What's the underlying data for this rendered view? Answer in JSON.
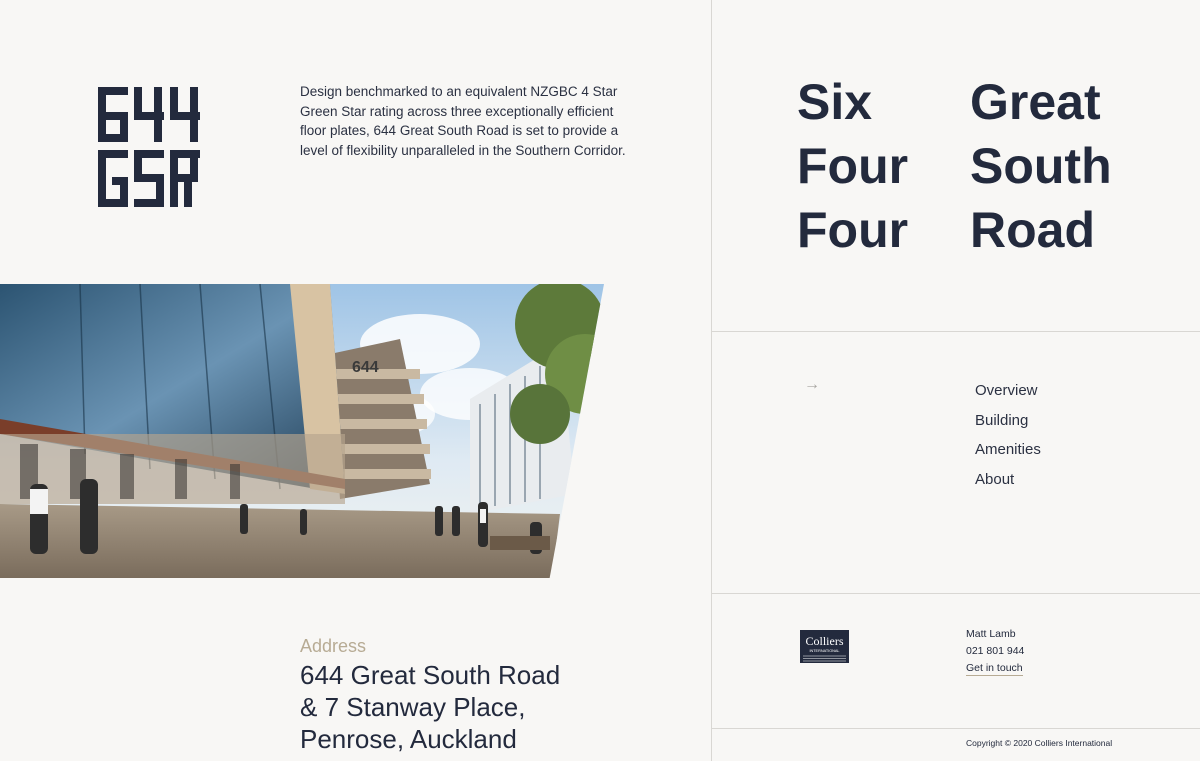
{
  "brand": {
    "logo_lines": [
      "644",
      "GSR"
    ]
  },
  "intro": {
    "text": "Design benchmarked to an equivalent NZGBC 4 Star Green Star rating across three exceptionally efficient floor plates, 644 Great South Road is set to provide a level of flexibility unparalleled in the Southern Corridor."
  },
  "address": {
    "label": "Address",
    "lines": [
      "644 Great South Road",
      "& 7 Stanway Place,",
      "Penrose, Auckland"
    ]
  },
  "title": {
    "col1": [
      "Six",
      "Four",
      "Four"
    ],
    "col2": [
      "Great",
      "South",
      "Road"
    ]
  },
  "nav": {
    "arrow": "→",
    "items": [
      "Overview",
      "Building",
      "Amenities",
      "About"
    ]
  },
  "agent": {
    "logo_text": "Colliers",
    "logo_subtext": "INTERNATIONAL",
    "name": "Matt Lamb",
    "phone": "021 801 944",
    "cta": "Get in touch"
  },
  "footer": {
    "copyright": "Copyright © 2020 Colliers International"
  },
  "colors": {
    "navy": "#232a3d",
    "tan": "#b7ab94",
    "background": "#f8f7f5"
  }
}
